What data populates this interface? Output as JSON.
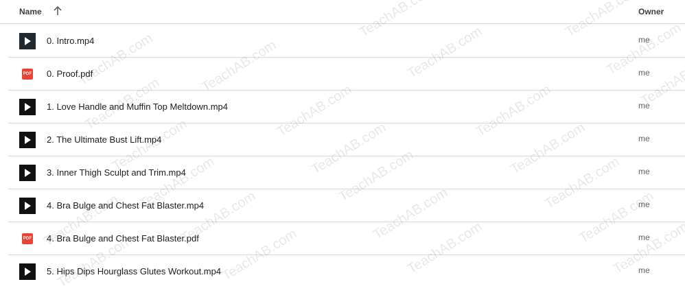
{
  "header": {
    "name_label": "Name",
    "owner_label": "Owner",
    "sort_icon": "arrow-up-icon"
  },
  "files": [
    {
      "name": "0. Intro.mp4",
      "type": "video",
      "owner": "me"
    },
    {
      "name": "0. Proof.pdf",
      "type": "pdf",
      "owner": "me"
    },
    {
      "name": "1. Love Handle and Muffin Top Meltdown.mp4",
      "type": "video",
      "owner": "me"
    },
    {
      "name": "2. The Ultimate Bust Lift.mp4",
      "type": "video",
      "owner": "me"
    },
    {
      "name": "3. Inner Thigh Sculpt and Trim.mp4",
      "type": "video",
      "owner": "me"
    },
    {
      "name": "4. Bra Bulge and Chest Fat Blaster.mp4",
      "type": "video",
      "owner": "me"
    },
    {
      "name": "4. Bra Bulge and Chest Fat Blaster.pdf",
      "type": "pdf",
      "owner": "me"
    },
    {
      "name": "5. Hips Dips Hourglass Glutes Workout.mp4",
      "type": "video",
      "owner": "me"
    }
  ],
  "pdf_badge": "PDF",
  "watermark": "TeachAB.com",
  "colors": {
    "pdf": "#ea4335",
    "video": "#111111",
    "divider": "#dadce0"
  }
}
